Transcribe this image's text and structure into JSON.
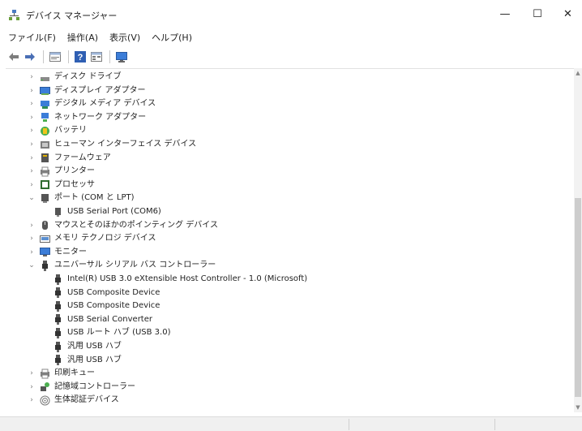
{
  "window": {
    "title": "デバイス マネージャー",
    "controls": {
      "minimize": "—",
      "maximize": "☐",
      "close": "✕"
    }
  },
  "menu": [
    {
      "label": "ファイル(F)"
    },
    {
      "label": "操作(A)"
    },
    {
      "label": "表示(V)"
    },
    {
      "label": "ヘルプ(H)"
    }
  ],
  "toolbar": [
    "back-icon",
    "forward-icon",
    "properties-icon",
    "help-icon",
    "list-view-icon",
    "monitor-icon"
  ],
  "tree": [
    {
      "label": "ディスク ドライブ",
      "expander": "›",
      "icon": "disk-drive-icon",
      "level": 0
    },
    {
      "label": "ディスプレイ アダプター",
      "expander": "›",
      "icon": "display-adapter-icon",
      "level": 0
    },
    {
      "label": "デジタル メディア デバイス",
      "expander": "›",
      "icon": "digital-media-icon",
      "level": 0
    },
    {
      "label": "ネットワーク アダプター",
      "expander": "›",
      "icon": "network-adapter-icon",
      "level": 0
    },
    {
      "label": "バッテリ",
      "expander": "›",
      "icon": "battery-icon",
      "level": 0
    },
    {
      "label": "ヒューマン インターフェイス デバイス",
      "expander": "›",
      "icon": "hid-icon",
      "level": 0
    },
    {
      "label": "ファームウェア",
      "expander": "›",
      "icon": "firmware-icon",
      "level": 0
    },
    {
      "label": "プリンター",
      "expander": "›",
      "icon": "printer-icon",
      "level": 0
    },
    {
      "label": "プロセッサ",
      "expander": "›",
      "icon": "processor-icon",
      "level": 0
    },
    {
      "label": "ポート (COM と LPT)",
      "expander": "⌄",
      "icon": "port-icon",
      "level": 0
    },
    {
      "label": "USB Serial Port (COM6)",
      "expander": "",
      "icon": "port-device-icon",
      "level": 1
    },
    {
      "label": "マウスとそのほかのポインティング デバイス",
      "expander": "›",
      "icon": "mouse-icon",
      "level": 0
    },
    {
      "label": "メモリ テクノロジ デバイス",
      "expander": "›",
      "icon": "memory-icon",
      "level": 0
    },
    {
      "label": "モニター",
      "expander": "›",
      "icon": "monitor-icon",
      "level": 0
    },
    {
      "label": "ユニバーサル シリアル バス コントローラー",
      "expander": "⌄",
      "icon": "usb-icon",
      "level": 0
    },
    {
      "label": "Intel(R) USB 3.0 eXtensible Host Controller - 1.0 (Microsoft)",
      "expander": "",
      "icon": "usb-device-icon",
      "level": 1
    },
    {
      "label": "USB Composite Device",
      "expander": "",
      "icon": "usb-device-icon",
      "level": 1
    },
    {
      "label": "USB Composite Device",
      "expander": "",
      "icon": "usb-device-icon",
      "level": 1
    },
    {
      "label": "USB Serial Converter",
      "expander": "",
      "icon": "usb-device-icon",
      "level": 1
    },
    {
      "label": "USB ルート ハブ (USB 3.0)",
      "expander": "",
      "icon": "usb-device-icon",
      "level": 1
    },
    {
      "label": "汎用 USB ハブ",
      "expander": "",
      "icon": "usb-device-icon",
      "level": 1
    },
    {
      "label": "汎用 USB ハブ",
      "expander": "",
      "icon": "usb-device-icon",
      "level": 1
    },
    {
      "label": "印刷キュー",
      "expander": "›",
      "icon": "print-queue-icon",
      "level": 0
    },
    {
      "label": "記憶域コントローラー",
      "expander": "›",
      "icon": "storage-controller-icon",
      "level": 0
    },
    {
      "label": "生体認証デバイス",
      "expander": "›",
      "icon": "biometric-icon",
      "level": 0
    }
  ]
}
